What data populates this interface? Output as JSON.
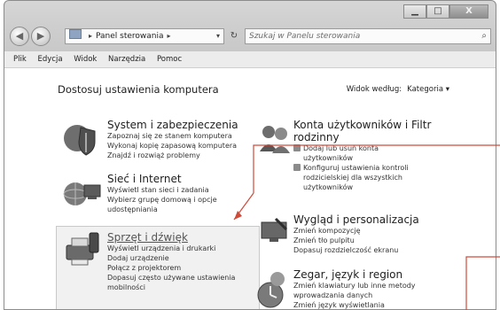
{
  "window": {
    "caption_buttons": [
      {
        "name": "minimize",
        "glyph": "▁"
      },
      {
        "name": "maximize",
        "glyph": "□"
      },
      {
        "name": "close",
        "glyph": "X"
      }
    ]
  },
  "address": {
    "breadcrumbs": [
      "Panel sterowania"
    ],
    "arrow": "▸",
    "dropdown": "▾",
    "refresh": "↻"
  },
  "search": {
    "placeholder": "Szukaj w Panelu sterowania",
    "icon": "⌕"
  },
  "menu": [
    "Plik",
    "Edycja",
    "Widok",
    "Narzędzia",
    "Pomoc"
  ],
  "heading": "Dostosuj ustawienia komputera",
  "view_by": {
    "label": "Widok według:",
    "value": "Kategoria ▾"
  },
  "categories": [
    {
      "title": "System i zabezpieczenia",
      "links": [
        "Zapoznaj się ze stanem komputera",
        "Wykonaj kopię zapasową komputera",
        "Znajdź i rozwiąż problemy"
      ]
    },
    {
      "title": "Sieć i Internet",
      "links": [
        "Wyświetl stan sieci i zadania",
        "Wybierz grupę domową i opcje",
        "udostępniania"
      ]
    },
    {
      "title": "Sprzęt i dźwięk",
      "links": [
        "Wyświetl urządzenia i drukarki",
        "Dodaj urządzenie",
        "Połącz z projektorem",
        "Dopasuj często używane ustawienia",
        "mobilności"
      ]
    },
    {
      "title_lines": [
        "Konta użytkowników i Filtr",
        "rodzinny"
      ],
      "links": [
        "Dodaj lub usuń konta",
        "użytkowników",
        "Konfiguruj ustawienia kontroli",
        "rodzicielskiej dla wszystkich",
        "użytkowników"
      ]
    },
    {
      "title": "Wygląd i personalizacja",
      "links": [
        "Zmień kompozycję",
        "Zmień tło pulpitu",
        "Dopasuj rozdzielczość ekranu"
      ]
    },
    {
      "title": "Zegar, język i region",
      "links": [
        "Zmień klawiatury lub inne metody",
        "wprowadzania danych",
        "Zmień język wyświetlania"
      ]
    }
  ],
  "colors": {
    "annotation": "#d04a3a",
    "highlight": "#f1f1f1"
  }
}
